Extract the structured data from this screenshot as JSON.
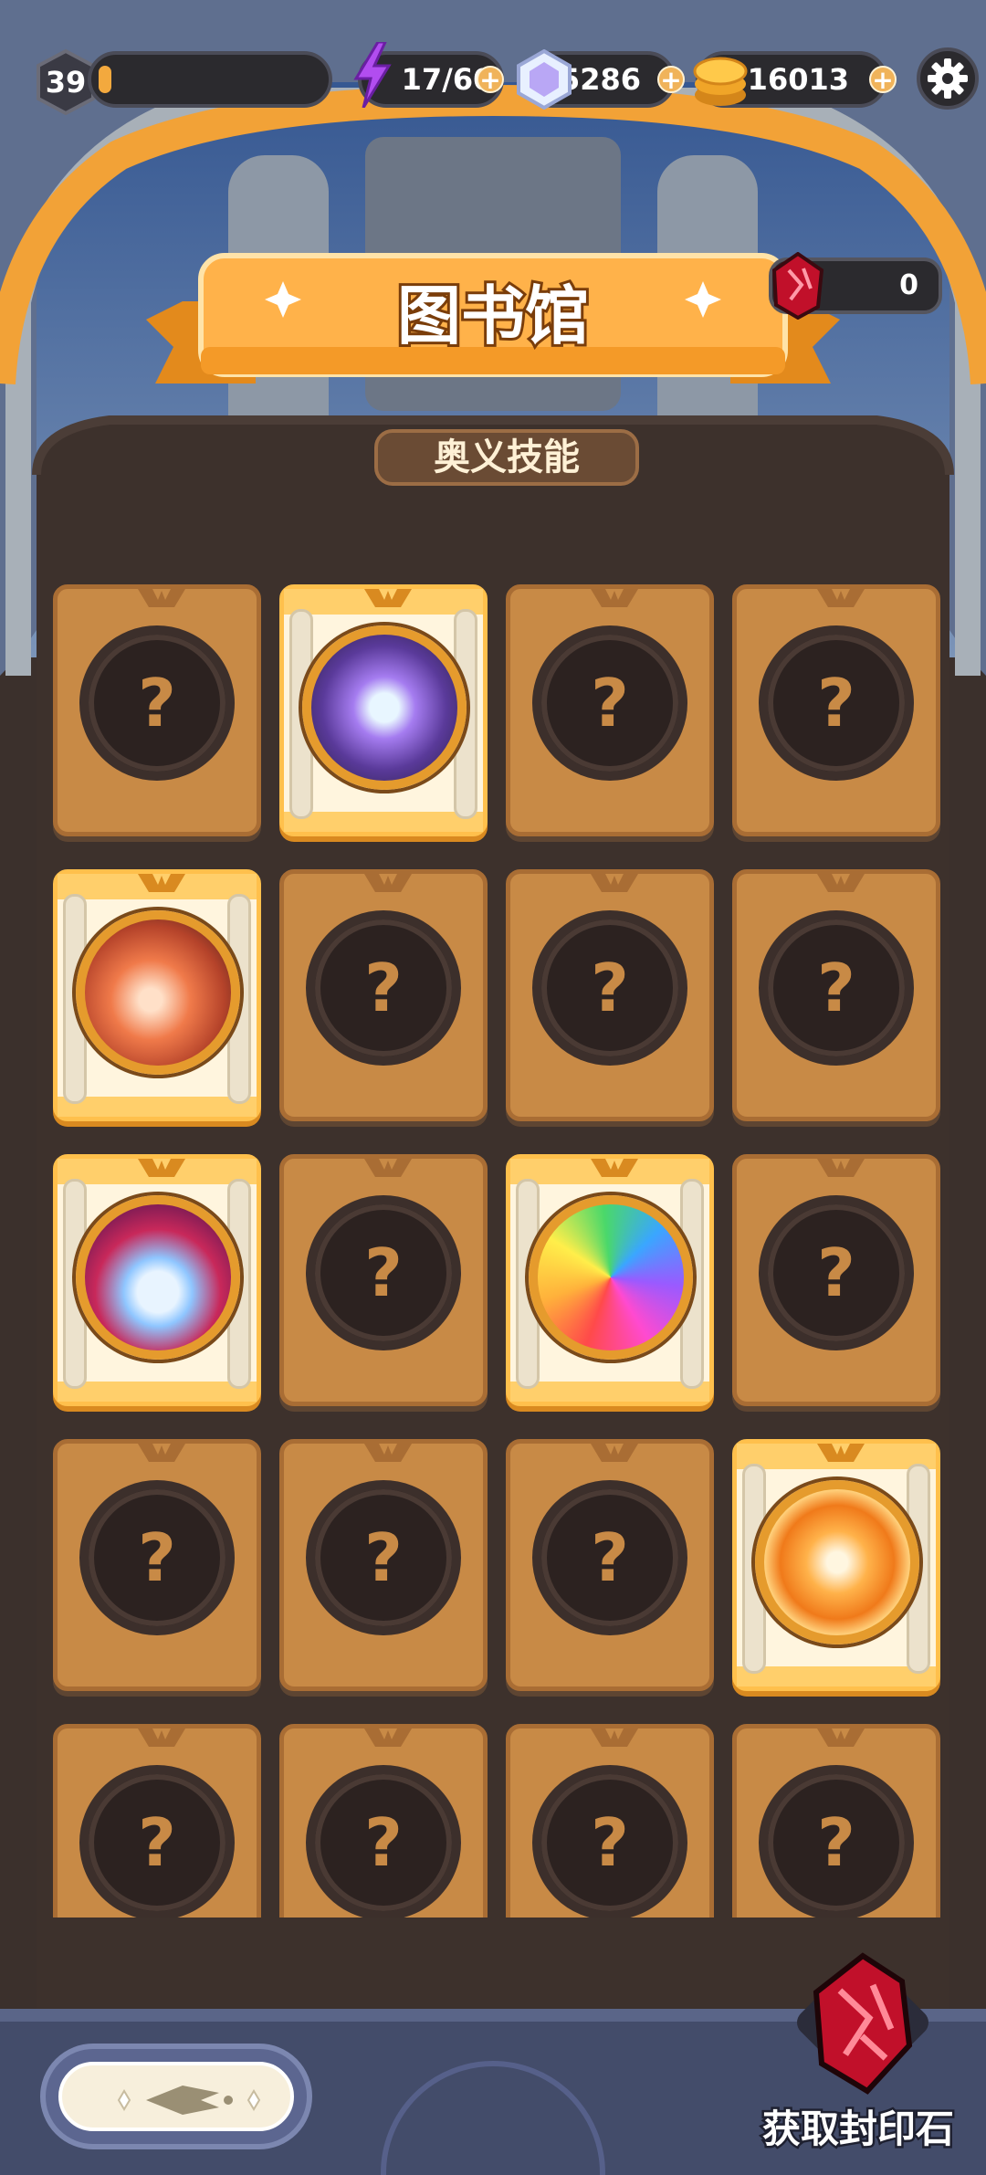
{
  "hud": {
    "level": "39",
    "energy": "17/60",
    "gems": "15286",
    "gold": "316013"
  },
  "banner": {
    "title": "图书馆",
    "subtitle": "奥义技能"
  },
  "seal": {
    "count": "0"
  },
  "grid": {
    "locked_symbol": "?"
  },
  "footer": {
    "get_seal_label": "获取封印石"
  },
  "colors": {
    "accent": "#f3a93e",
    "card_locked": "#c88a46",
    "card_unlocked_border": "#ffc04c",
    "background": "#3a2f2c"
  }
}
